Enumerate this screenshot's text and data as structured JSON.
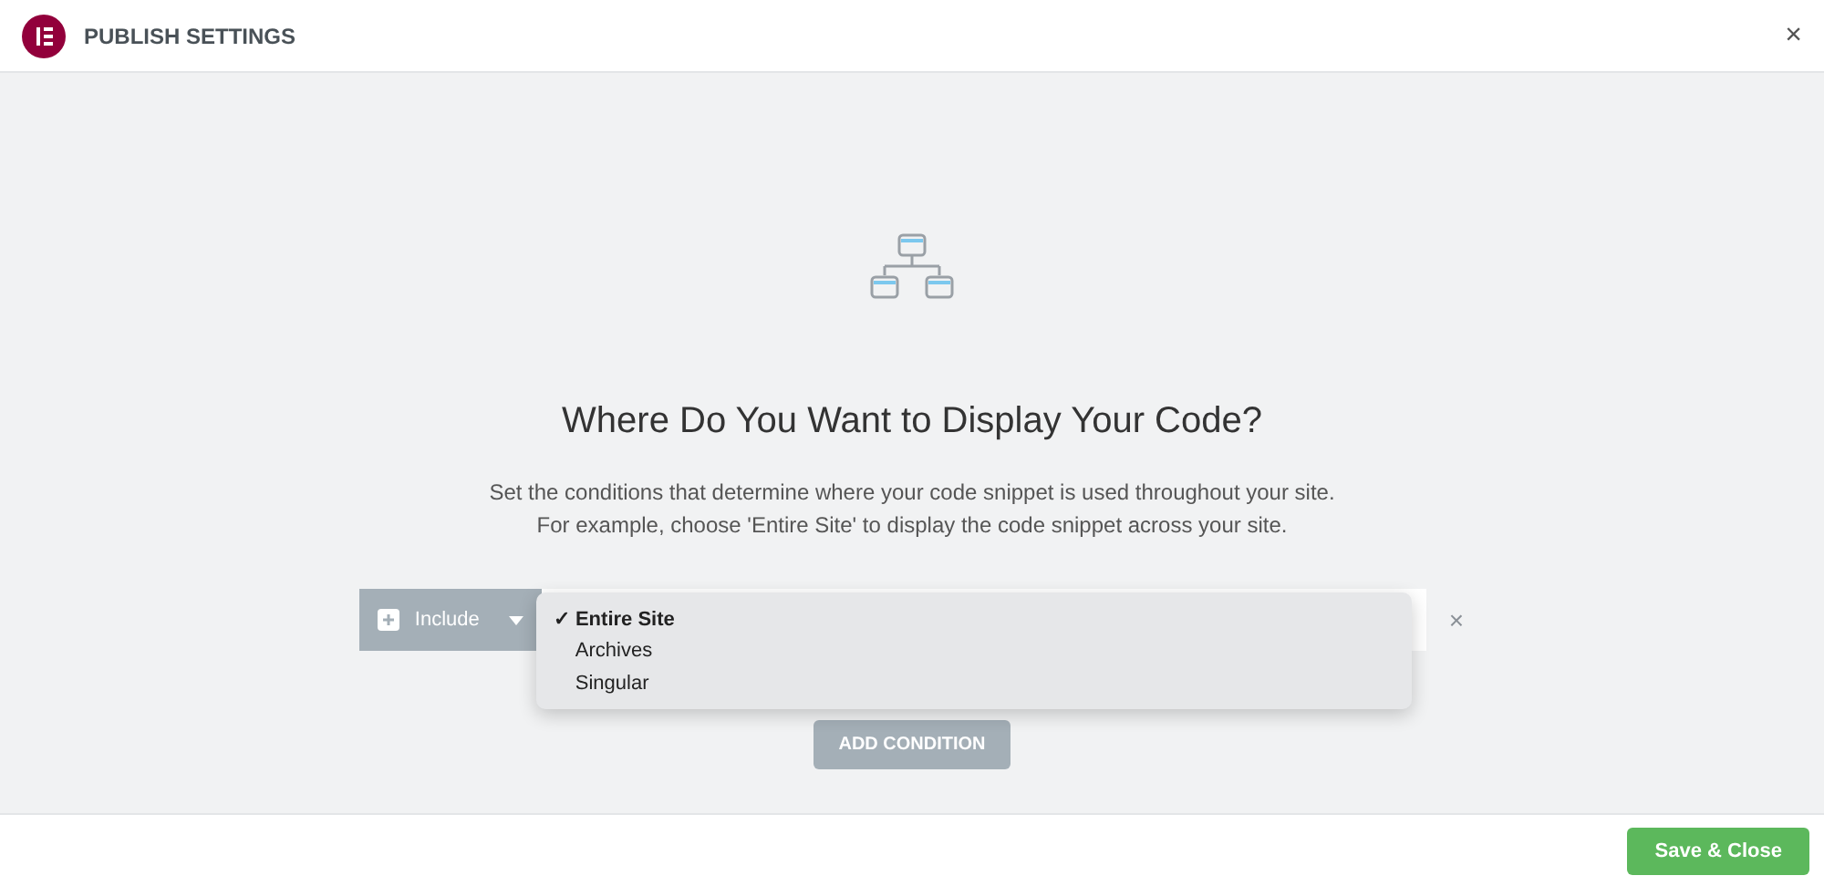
{
  "header": {
    "title": "PUBLISH SETTINGS",
    "close": "×"
  },
  "heading": "Where Do You Want to Display Your Code?",
  "description": [
    "Set the conditions that determine where your code snippet is used throughout your site.",
    "For example, choose 'Entire Site' to display the code snippet across your site."
  ],
  "condition": {
    "type": "Include",
    "remove": "×",
    "check": "✓",
    "options": [
      {
        "label": "Entire Site",
        "selected": true
      },
      {
        "label": "Archives",
        "selected": false
      },
      {
        "label": "Singular",
        "selected": false
      }
    ]
  },
  "add_button": "ADD CONDITION",
  "save_button": "Save & Close"
}
